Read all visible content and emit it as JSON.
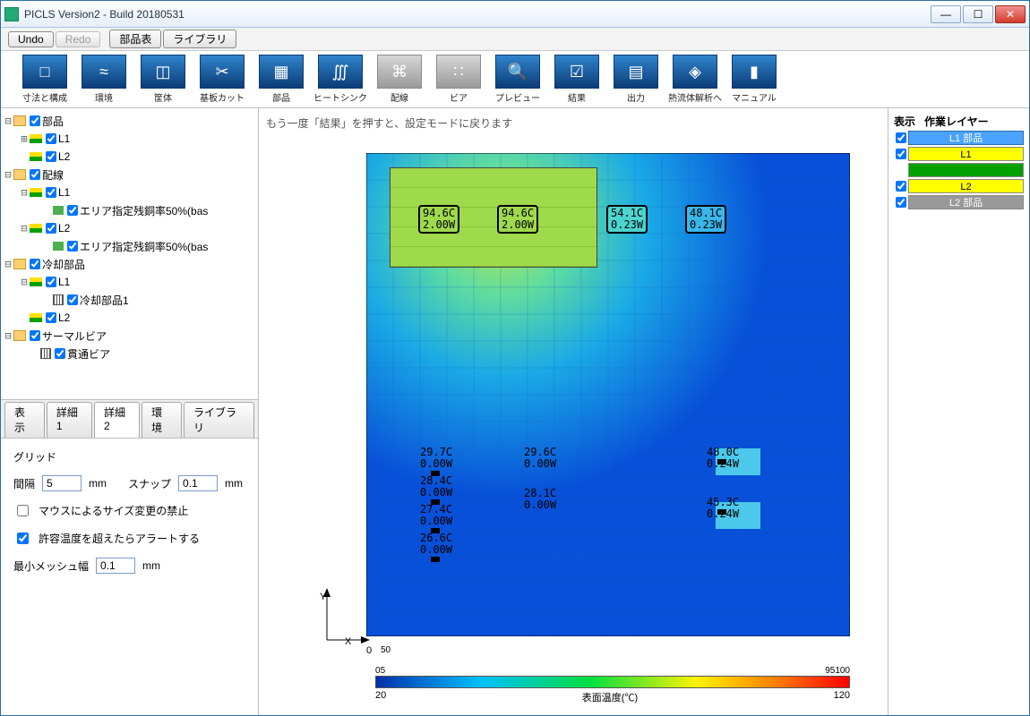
{
  "window": {
    "title": "PICLS Version2 - Build 20180531"
  },
  "smalltb": {
    "undo": "Undo",
    "redo": "Redo",
    "parts": "部品表",
    "library": "ライブラリ"
  },
  "toolbar": [
    {
      "label": "寸法と構成",
      "icon": "□",
      "kind": "blue"
    },
    {
      "label": "環境",
      "icon": "≈",
      "kind": "blue"
    },
    {
      "label": "筐体",
      "icon": "◫",
      "kind": "blue"
    },
    {
      "label": "基板カット",
      "icon": "✂",
      "kind": "blue"
    },
    {
      "label": "部品",
      "icon": "▦",
      "kind": "blue"
    },
    {
      "label": "ヒートシンク",
      "icon": "∭",
      "kind": "blue"
    },
    {
      "label": "配線",
      "icon": "⌘",
      "kind": "grey"
    },
    {
      "label": "ビア",
      "icon": "∷",
      "kind": "grey"
    },
    {
      "label": "プレビュー",
      "icon": "🔍",
      "kind": "blue"
    },
    {
      "label": "結果",
      "icon": "☑",
      "kind": "blue"
    },
    {
      "label": "出力",
      "icon": "▤",
      "kind": "blue"
    },
    {
      "label": "熱流体解析へ",
      "icon": "◈",
      "kind": "blue"
    },
    {
      "label": "マニュアル",
      "icon": "▮",
      "kind": "blue"
    }
  ],
  "tree": {
    "n0": "部品",
    "n1": "L1",
    "n2": "L2",
    "n3": "配線",
    "n4": "L1",
    "n5": "エリア指定残銅率50%(bas",
    "n6": "L2",
    "n7": "エリア指定残銅率50%(bas",
    "n8": "冷却部品",
    "n9": "L1",
    "n10": "冷却部品1",
    "n11": "L2",
    "n12": "サーマルビア",
    "n13": "貫通ビア"
  },
  "bottomTabs": {
    "t0": "表示",
    "t1": "詳細1",
    "t2": "詳細2",
    "t3": "環境",
    "t4": "ライブラリ"
  },
  "panel": {
    "grid": "グリッド",
    "spacing": "間隔",
    "spacing_val": "5",
    "mm": "mm",
    "snap": "スナップ",
    "snap_val": "0.1",
    "cb1": "マウスによるサイズ変更の禁止",
    "cb2": "許容温度を超えたらアラートする",
    "meshlabel": "最小メッシュ幅",
    "mesh_val": "0.1"
  },
  "msg": "もう一度「結果」を押すと、設定モードに戻ります",
  "axis": {
    "x": "X",
    "y": "Y",
    "x0": "0",
    "x1": "50"
  },
  "colorbar": {
    "min": "0",
    "a": "5",
    "b": "95",
    "max": "100",
    "low": "20",
    "high": "120",
    "title": "表面温度(℃)"
  },
  "comp": {
    "c1": {
      "t": "94.6C",
      "p": "2.00W"
    },
    "c2": {
      "t": "94.6C",
      "p": "2.00W"
    },
    "c3": {
      "t": "54.1C",
      "p": "0.23W"
    },
    "c4": {
      "t": "48.1C",
      "p": "0.23W"
    },
    "c5": {
      "t": "29.7C",
      "p": "0.00W"
    },
    "c6": {
      "t": "29.6C",
      "p": "0.00W"
    },
    "c7": {
      "t": "48.0C",
      "p": "0.24W"
    },
    "c8": {
      "t": "28.4C",
      "p": "0.00W"
    },
    "c9": {
      "t": "28.1C",
      "p": "0.00W"
    },
    "c10": {
      "t": "45.3C",
      "p": "0.24W"
    },
    "c11": {
      "t": "27.4C",
      "p": "0.00W"
    },
    "c12": {
      "t": "26.6C",
      "p": "0.00W"
    }
  },
  "right": {
    "hdr1": "表示",
    "hdr2": "作業レイヤー",
    "row1": "L1 部品",
    "row2": "L1",
    "row3": "",
    "row4": "L2",
    "row5": "L2 部品"
  },
  "chart_data": {
    "type": "heatmap",
    "title": "表面温度(℃)",
    "xlabel": "X",
    "ylabel": "Y",
    "x_range_mm": [
      0,
      50
    ],
    "colorbar_range_C": [
      0,
      100
    ],
    "display_range_C": [
      20,
      120
    ],
    "pcb_region_mm": {
      "x": [
        3,
        25
      ],
      "y_from_top": [
        2,
        13
      ]
    },
    "components": [
      {
        "id": "c1",
        "temperature_C": 94.6,
        "power_W": 2.0,
        "region": "pcb-top"
      },
      {
        "id": "c2",
        "temperature_C": 94.6,
        "power_W": 2.0,
        "region": "pcb-top"
      },
      {
        "id": "c3",
        "temperature_C": 54.1,
        "power_W": 0.23,
        "region": "top-right"
      },
      {
        "id": "c4",
        "temperature_C": 48.1,
        "power_W": 0.23,
        "region": "top-right"
      },
      {
        "id": "c5",
        "temperature_C": 29.7,
        "power_W": 0.0,
        "region": "lower-left"
      },
      {
        "id": "c6",
        "temperature_C": 29.6,
        "power_W": 0.0,
        "region": "lower-mid"
      },
      {
        "id": "c7",
        "temperature_C": 48.0,
        "power_W": 0.24,
        "region": "lower-right"
      },
      {
        "id": "c8",
        "temperature_C": 28.4,
        "power_W": 0.0,
        "region": "lower-left"
      },
      {
        "id": "c9",
        "temperature_C": 28.1,
        "power_W": 0.0,
        "region": "lower-mid"
      },
      {
        "id": "c10",
        "temperature_C": 45.3,
        "power_W": 0.24,
        "region": "lower-right"
      },
      {
        "id": "c11",
        "temperature_C": 27.4,
        "power_W": 0.0,
        "region": "lower-left"
      },
      {
        "id": "c12",
        "temperature_C": 26.6,
        "power_W": 0.0,
        "region": "lower-left"
      }
    ]
  }
}
